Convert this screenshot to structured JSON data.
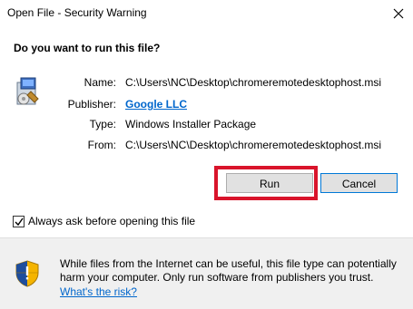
{
  "window": {
    "title": "Open File - Security Warning"
  },
  "question": "Do you want to run this file?",
  "details": {
    "name_label": "Name:",
    "name_value": "C:\\Users\\NC\\Desktop\\chromeremotedesktophost.msi",
    "publisher_label": "Publisher:",
    "publisher_value": "Google LLC",
    "type_label": "Type:",
    "type_value": "Windows Installer Package",
    "from_label": "From:",
    "from_value": "C:\\Users\\NC\\Desktop\\chromeremotedesktophost.msi"
  },
  "buttons": {
    "run": "Run",
    "cancel": "Cancel"
  },
  "checkbox": {
    "label": "Always ask before opening this file",
    "checked": true
  },
  "warning": {
    "text": "While files from the Internet can be useful, this file type can potentially harm your computer. Only run software from publishers you trust.",
    "link": "What's the risk?"
  },
  "colors": {
    "highlight": "#d9142b",
    "link": "#0066cc",
    "focus_border": "#0078d7"
  },
  "icons": [
    "close-icon",
    "installer-package-icon",
    "checkmark-icon",
    "security-shield-icon"
  ]
}
